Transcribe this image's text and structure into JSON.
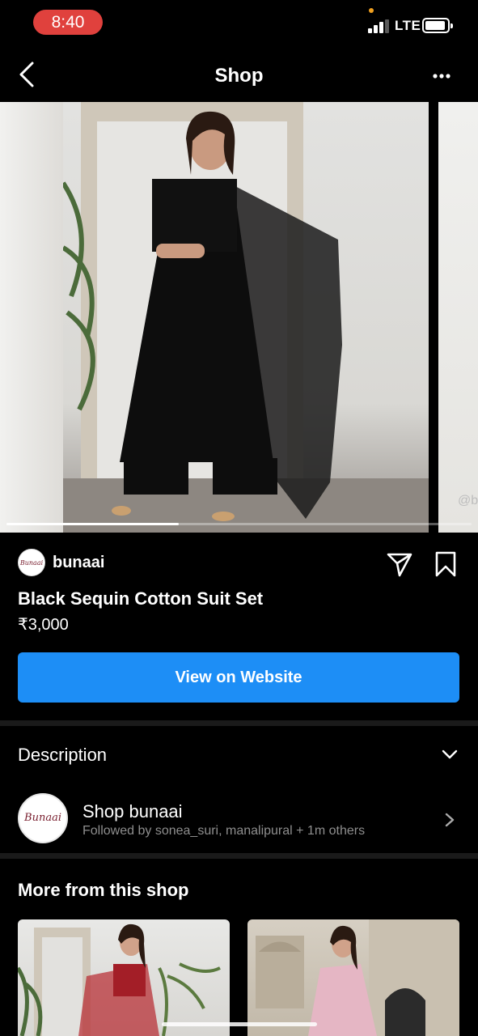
{
  "status_bar": {
    "time": "8:40",
    "network": "LTE",
    "time_pill_color": "#e0413d"
  },
  "nav": {
    "title": "Shop",
    "back_icon": "chevron-left-icon",
    "more_icon": "more-horizontal-icon"
  },
  "hero": {
    "watermark": "@b",
    "carousel_progress": 0.37
  },
  "seller": {
    "name": "bunaai",
    "avatar_text": "Bunaai"
  },
  "product": {
    "title": "Black Sequin Cotton Suit Set",
    "price": "₹3,000"
  },
  "cta": {
    "label": "View on Website",
    "color": "#1d8ef6"
  },
  "description": {
    "label": "Description"
  },
  "shop": {
    "name": "Shop bunaai",
    "followed_by": "Followed by sonea_suri, manalipural + 1m others",
    "avatar_text": "Bunaai"
  },
  "more_from_shop": {
    "title": "More from this shop"
  }
}
